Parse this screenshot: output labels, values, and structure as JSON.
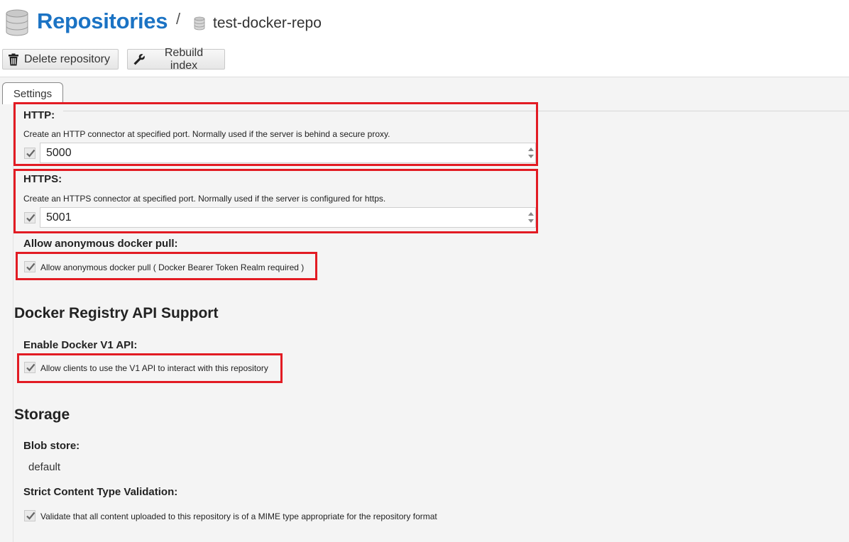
{
  "breadcrumb": {
    "root": "Repositories",
    "separator": "/",
    "leaf": "test-docker-repo"
  },
  "toolbar": {
    "delete_label": "Delete repository",
    "rebuild_label": "Rebuild index"
  },
  "tabs": [
    "Settings"
  ],
  "http": {
    "label": "HTTP:",
    "help": "Create an HTTP connector at specified port. Normally used if the server is behind a secure proxy.",
    "enabled": true,
    "value": "5000"
  },
  "https": {
    "label": "HTTPS:",
    "help": "Create an HTTPS connector at specified port. Normally used if the server is configured for https.",
    "enabled": true,
    "value": "5001"
  },
  "anonymous_pull": {
    "label": "Allow anonymous docker pull:",
    "checkbox_label": "Allow anonymous docker pull ( Docker Bearer Token Realm required )",
    "checked": true
  },
  "registry_api": {
    "heading": "Docker Registry API Support",
    "v1_label": "Enable Docker V1 API:",
    "v1_checkbox_label": "Allow clients to use the V1 API to interact with this repository",
    "checked": true
  },
  "storage": {
    "heading": "Storage",
    "blob_store_label": "Blob store:",
    "blob_store_value": "default",
    "strict_label": "Strict Content Type Validation:",
    "strict_checkbox_label": "Validate that all content uploaded to this repository is of a MIME type appropriate for the repository format",
    "checked": true
  },
  "colors": {
    "accent": "#1b73c4",
    "highlight": "#e21b23"
  },
  "icons": [
    "database-icon",
    "trash-icon",
    "wrench-icon",
    "checkmark-icon",
    "spinner-icon"
  ]
}
